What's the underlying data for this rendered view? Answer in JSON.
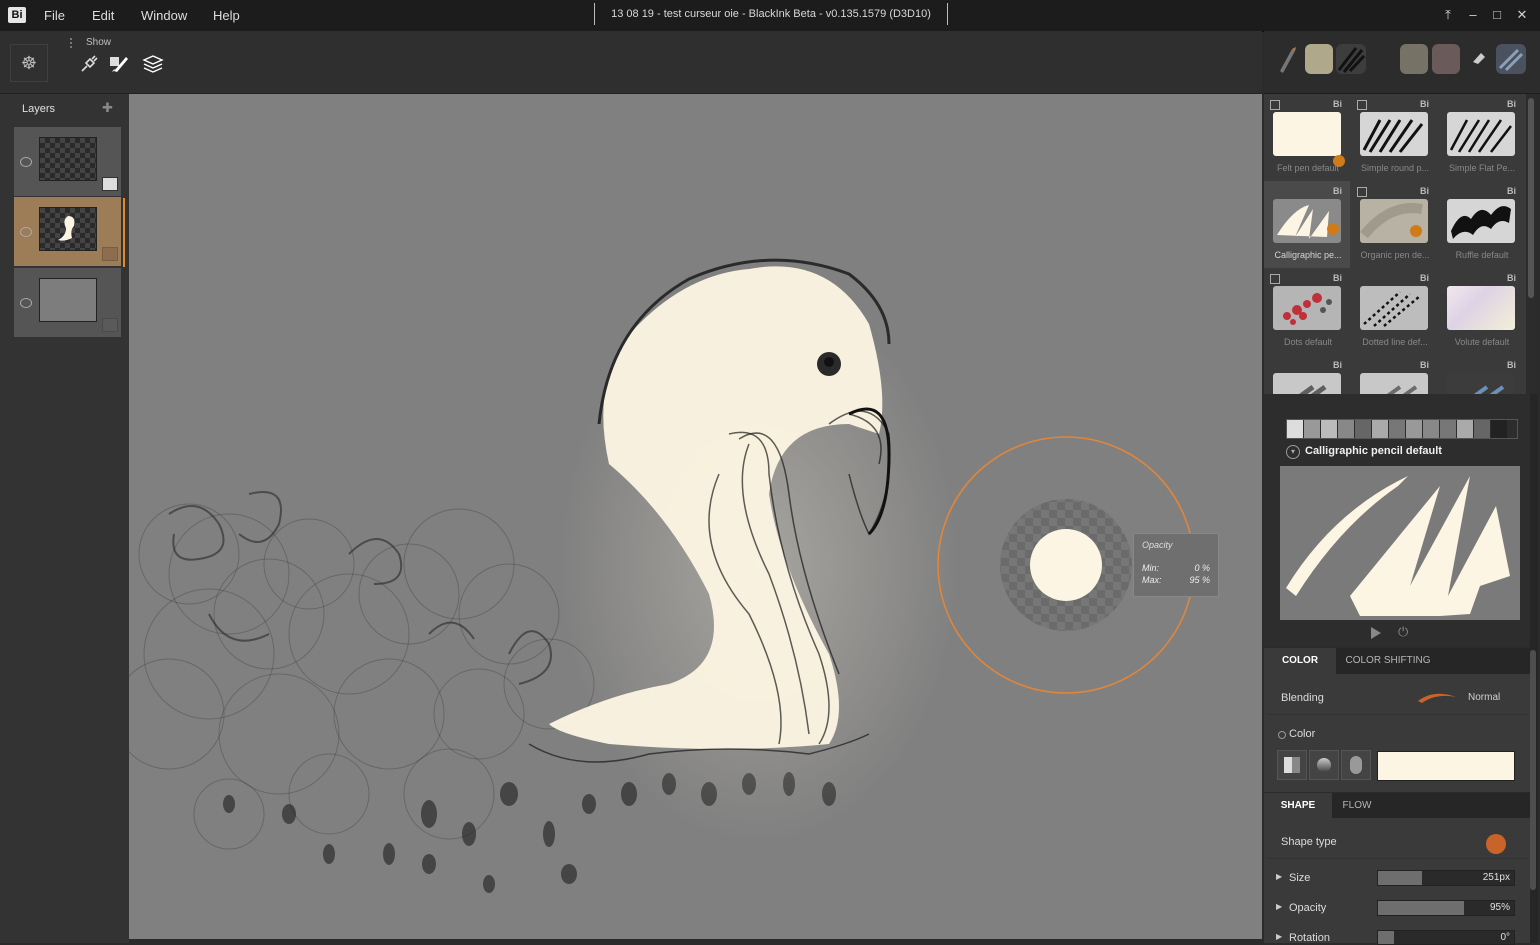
{
  "app": {
    "logo": "Bi",
    "title": "13 08 19 - test curseur oie - BlackInk Beta - v0.135.1579 (D3D10)"
  },
  "menu": [
    "File",
    "Edit",
    "Window",
    "Help"
  ],
  "window_controls": {
    "pin": "⤒",
    "minimize": "–",
    "maximize": "□",
    "close": "✕"
  },
  "toolbar": {
    "settings_icon": "ship-wheel-icon",
    "show_label": "Show",
    "tools": [
      "plug-icon",
      "brush-icon",
      "layers-icon"
    ]
  },
  "layers_panel": {
    "title": "Layers",
    "layers": [
      {
        "name": "layer-1",
        "selected": false
      },
      {
        "name": "layer-2",
        "selected": true
      },
      {
        "name": "layer-3",
        "selected": false
      }
    ]
  },
  "brushes": [
    {
      "name": "Felt pen default",
      "selected": false
    },
    {
      "name": "Simple round p...",
      "selected": false
    },
    {
      "name": "Simple Flat Pe...",
      "selected": false
    },
    {
      "name": "Calligraphic pe...",
      "selected": true
    },
    {
      "name": "Organic pen de...",
      "selected": false
    },
    {
      "name": "Ruffle default",
      "selected": false
    },
    {
      "name": "Dots default",
      "selected": false
    },
    {
      "name": "Dotted line def...",
      "selected": false
    },
    {
      "name": "Volute default",
      "selected": false
    }
  ],
  "brush_badge": "Bi",
  "preset": {
    "name": "Calligraphic pencil default"
  },
  "color_tabs": {
    "active": "COLOR",
    "inactive": "COLOR SHIFTING"
  },
  "blending": {
    "label": "Blending",
    "value": "Normal"
  },
  "color": {
    "label": "Color",
    "value": "#fdf5e3"
  },
  "shape_tabs": {
    "active": "SHAPE",
    "inactive": "FLOW"
  },
  "shape": {
    "type_label": "Shape type",
    "sliders": [
      {
        "label": "Size",
        "value": "251px",
        "fill": 0.33
      },
      {
        "label": "Opacity",
        "value": "95%",
        "fill": 0.63
      },
      {
        "label": "Rotation",
        "value": "0°",
        "fill": 0.12
      }
    ]
  },
  "cursor_tooltip": {
    "title": "Opacity",
    "min_label": "Min:",
    "min_value": "0 %",
    "max_label": "Max:",
    "max_value": "95 %"
  },
  "colors": {
    "accent": "#e08a2a",
    "paper": "#fdf5e3",
    "canvas": "#808080"
  }
}
